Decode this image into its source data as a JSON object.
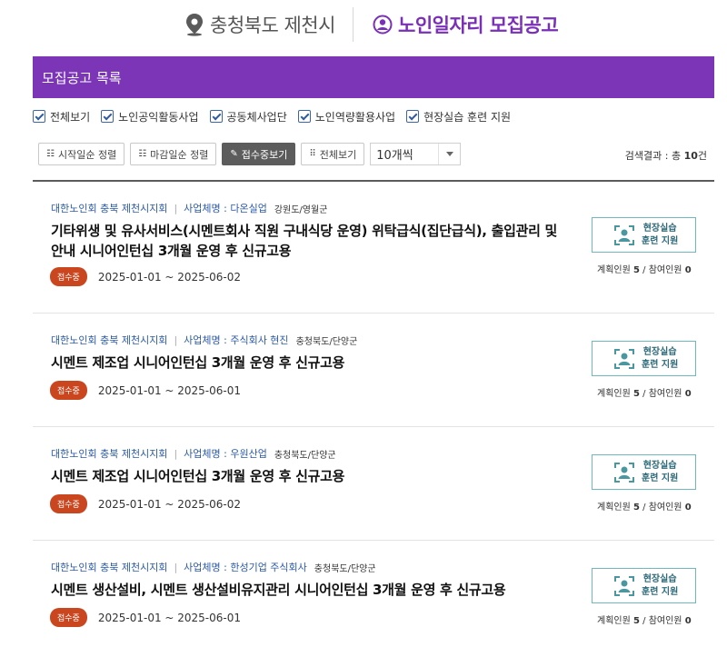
{
  "header": {
    "location": "충청북도 제천시",
    "title": "노인일자리 모집공고",
    "colors": {
      "accent": "#7a2fb8",
      "location_text": "#555555"
    }
  },
  "banner": {
    "title": "모집공고 목록",
    "color": "#7b35b6"
  },
  "filters": [
    {
      "label": "전체보기",
      "checked": true
    },
    {
      "label": "노인공익활동사업",
      "checked": true
    },
    {
      "label": "공동체사업단",
      "checked": true
    },
    {
      "label": "노인역량활용사업",
      "checked": true
    },
    {
      "label": "현장실습 훈련 지원",
      "checked": true
    }
  ],
  "toolbar": {
    "sort_start": "시작일순 정렬",
    "sort_end": "마감일순 정렬",
    "view_open": "접수중보기",
    "view_all": "전체보기",
    "page_size": "10개씩",
    "result_prefix": "검색결과 : 총 ",
    "result_count": "10",
    "result_suffix": "건"
  },
  "jobs": [
    {
      "org": "대한노인회 충북 제천시지회",
      "company": "사업체명 : 다온실업",
      "region": "강원도/영월군",
      "title": "기타위생 및 유사서비스(시멘트회사 직원 구내식당 운영) 위탁급식(집단급식), 출입관리 및 안내 시니어인턴십 3개월 운영 후 신규고용",
      "status": "접수중",
      "period": "2025-01-01 ~ 2025-06-02",
      "program_line1": "현장실습",
      "program_line2": "훈련 지원",
      "plan_label": "계획인원",
      "plan": "5",
      "join_label": "참여인원",
      "join": "0"
    },
    {
      "org": "대한노인회 충북 제천시지회",
      "company": "사업체명 : 주식회사 현진",
      "region": "충청북도/단양군",
      "title": "시멘트 제조업 시니어인턴십 3개월 운영 후 신규고용",
      "status": "접수중",
      "period": "2025-01-01 ~ 2025-06-01",
      "program_line1": "현장실습",
      "program_line2": "훈련 지원",
      "plan_label": "계획인원",
      "plan": "5",
      "join_label": "참여인원",
      "join": "0"
    },
    {
      "org": "대한노인회 충북 제천시지회",
      "company": "사업체명 : 우원산업",
      "region": "충청북도/단양군",
      "title": "시멘트 제조업 시니어인턴십 3개월 운영 후 신규고용",
      "status": "접수중",
      "period": "2025-01-01 ~ 2025-06-02",
      "program_line1": "현장실습",
      "program_line2": "훈련 지원",
      "plan_label": "계획인원",
      "plan": "5",
      "join_label": "참여인원",
      "join": "0"
    },
    {
      "org": "대한노인회 충북 제천시지회",
      "company": "사업체명 : 한성기업 주식회사",
      "region": "충청북도/단양군",
      "title": "시멘트 생산설비, 시멘트 생산설비유지관리 시니어인턴십 3개월 운영 후 신규고용",
      "status": "접수중",
      "period": "2025-01-01 ~ 2025-06-01",
      "program_line1": "현장실습",
      "program_line2": "훈련 지원",
      "plan_label": "계획인원",
      "plan": "5",
      "join_label": "참여인원",
      "join": "0"
    }
  ],
  "colors": {
    "status_badge": "#c9461f",
    "link_blue": "#2b5aa8",
    "program_border": "#6fb8be",
    "program_text": "#2d6a7a"
  }
}
